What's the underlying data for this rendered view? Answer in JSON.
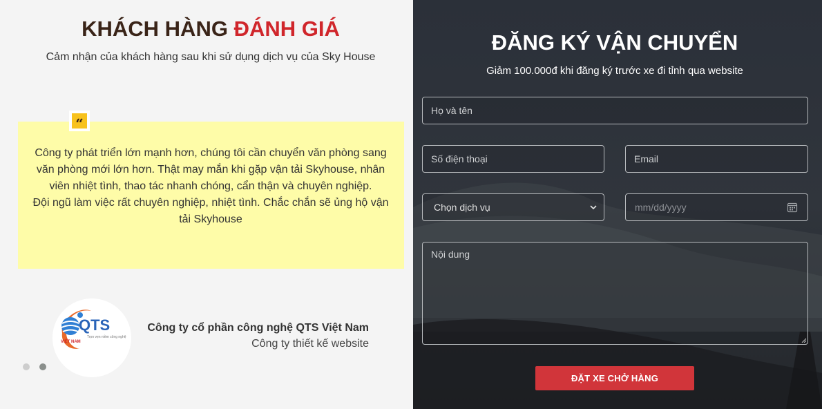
{
  "testimonials": {
    "title_part1": "KHÁCH HÀNG",
    "title_part2": "ĐÁNH GIÁ",
    "subtitle": "Cảm nhận của khách hàng sau khi sử dụng dịch vụ của Sky House",
    "quote_icon": "quote-icon",
    "quote_lines": [
      "Công ty phát triển lớn mạnh hơn, chúng tôi cần chuyển văn phòng sang",
      "văn phòng mới lớn hơn. Thật may mắn khi gặp vận tải Skyhouse, nhân",
      "viên nhiệt tình, thao tác nhanh chóng, cẩn thận và chuyên nghiệp.",
      "Đội ngũ làm việc rất chuyên nghiệp, nhiệt tình. Chắc chắn sẽ ủng hộ vận",
      "tải Skyhouse"
    ],
    "company_name": "Công ty cổ phần công nghệ QTS Việt Nam",
    "company_sub": "Công ty thiết kế website",
    "logo": {
      "text": "QTS",
      "tagline": "Trọn vẹn niềm công nghệ",
      "country": "VIỆT NAM"
    },
    "slide_count": 2,
    "active_slide": 2
  },
  "form": {
    "title": "ĐĂNG KÝ VẬN CHUYỂN",
    "subtitle": "Giảm 100.000đ khi đăng ký trước xe đi tỉnh qua website",
    "name_placeholder": "Họ và tên",
    "phone_placeholder": "Số điện thoại",
    "email_placeholder": "Email",
    "service_selected": "Chọn dịch vụ",
    "date_placeholder": "mm/dd/yyyy",
    "content_placeholder": "Nội dung",
    "submit_label": "ĐẶT XE CHỞ HÀNG"
  },
  "colors": {
    "accent_red": "#d0262b",
    "quote_bg": "#fefca8",
    "quote_icon_bg": "#f8c21d",
    "button_bg": "#d1353a"
  }
}
